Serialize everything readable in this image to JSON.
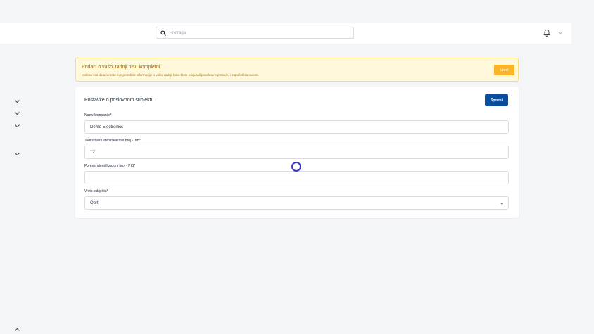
{
  "header": {
    "search_placeholder": "Pretraga",
    "icons": [
      "search-icon",
      "bell-icon",
      "chevron-down-icon"
    ]
  },
  "sidebar": {
    "icons": [
      "chevron-down-icon",
      "chevron-down-icon",
      "chevron-down-icon",
      "chevron-down-icon",
      "chevron-up-icon"
    ]
  },
  "alert": {
    "title": "Podaci o vašoj radnji nisu kompletni.",
    "message": "Molimo vas da ažurirate sve potrebne informacije o vašoj radnji kako biste osigurali pravilnu registraciju i započeli sa radom.",
    "button_label": "Uredi"
  },
  "form": {
    "title": "Postavke o poslovnom subjektu",
    "save_label": "Spremi",
    "fields": {
      "company_name": {
        "label": "Naziv kompanije*",
        "value": "Demo Electronics"
      },
      "jib": {
        "label": "Jedinstveni identifikacioni broj - JIB*",
        "value": "12"
      },
      "pib": {
        "label": "Poreski identifikacioni broj - PIB*",
        "value": ""
      },
      "entity_type": {
        "label": "Vrsta subjekta*",
        "value": "Obrt"
      }
    }
  },
  "colors": {
    "primary": "#0a4d9c",
    "warning_bg": "#fff8db",
    "warning_button": "#f9b428",
    "cursor": "#3b38c4"
  }
}
